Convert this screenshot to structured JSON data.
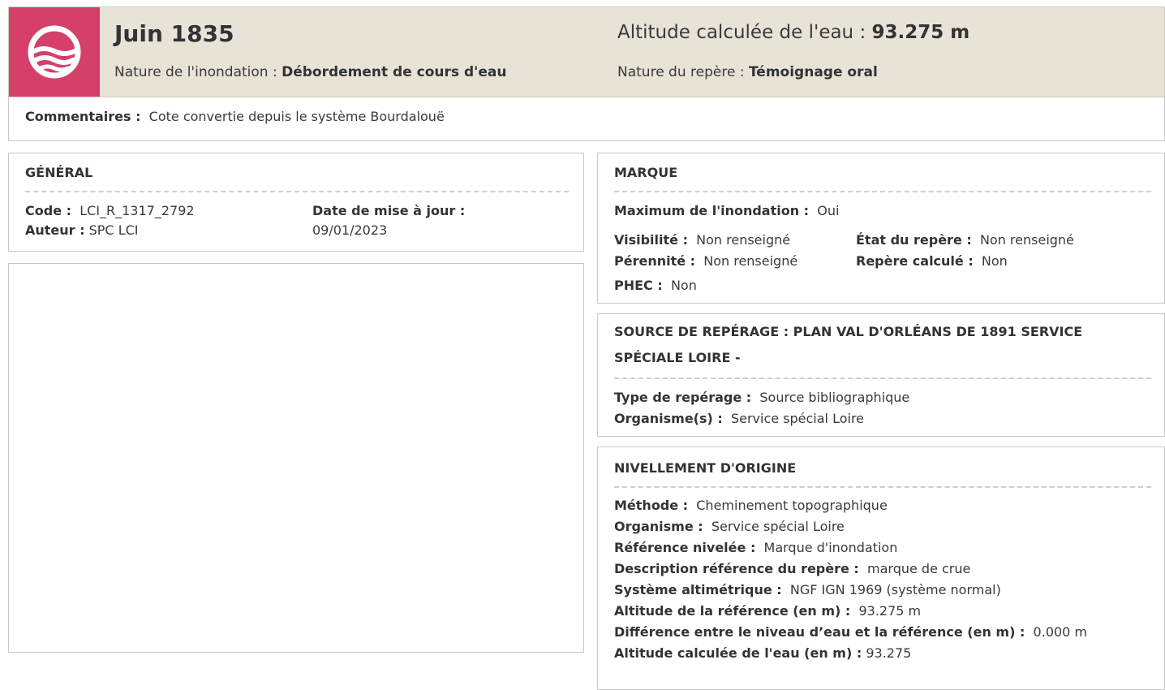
{
  "header": {
    "title": "Juin 1835",
    "nature_label": "Nature de l'inondation :",
    "nature_value": "Débordement de cours d'eau",
    "altitude_label": "Altitude calculée de l'eau :",
    "altitude_value": "93.275 m",
    "repere_label": "Nature du repère :",
    "repere_value": "Témoignage oral",
    "logo_icon": "water-waves-icon",
    "logo_color": "#d4406a"
  },
  "comment": {
    "label": "Commentaires :",
    "value": "Cote convertie depuis le système Bourdalouë"
  },
  "general": {
    "title": "GÉNÉRAL",
    "code_label": "Code :",
    "code_value": "LCI_R_1317_2792",
    "auteur_label": "Auteur :",
    "auteur_value": "SPC LCI",
    "date_label": "Date de mise à jour :",
    "date_value": "09/01/2023"
  },
  "marque": {
    "title": "MARQUE",
    "max_label": "Maximum de l'inondation :",
    "max_value": "Oui",
    "visibilite_label": "Visibilité :",
    "visibilite_value": "Non renseigné",
    "etat_label": "État du repère :",
    "etat_value": "Non renseigné",
    "perennite_label": "Pérennité :",
    "perennite_value": "Non renseigné",
    "calcule_label": "Repère calculé :",
    "calcule_value": "Non",
    "phec_label": "PHEC :",
    "phec_value": "Non"
  },
  "source": {
    "title_line1": "SOURCE DE REPÉRAGE : PLAN VAL D'ORLÉANS DE 1891 SERVICE",
    "title_line2": "SPÉCIALE LOIRE -",
    "type_label": "Type de repérage :",
    "type_value": "Source bibliographique",
    "org_label": "Organisme(s) :",
    "org_value": "Service spécial Loire"
  },
  "nivellement": {
    "title": "NIVELLEMENT D'ORIGINE",
    "rows": [
      {
        "label": "Méthode :",
        "value": "Cheminement topographique"
      },
      {
        "label": "Organisme :",
        "value": "Service spécial Loire"
      },
      {
        "label": "Référence nivelée :",
        "value": "Marque d'inondation"
      },
      {
        "label": "Description référence du repère :",
        "value": "marque de crue"
      },
      {
        "label": "Système altimétrique :",
        "value": "NGF IGN 1969 (système normal)"
      },
      {
        "label": "Altitude de la référence (en m) :",
        "value": "93.275 m"
      },
      {
        "label": "Différence entre le niveau d’eau et la référence (en m) :",
        "value": "0.000 m"
      },
      {
        "label": "Altitude calculée de l'eau (en m) :",
        "value": "93.275"
      }
    ]
  }
}
